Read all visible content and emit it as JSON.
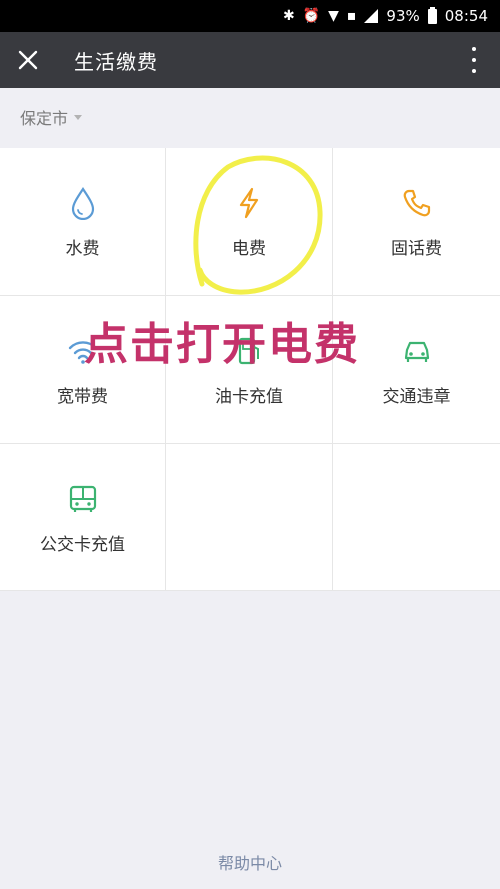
{
  "status_bar": {
    "battery": "93%",
    "time": "08:54"
  },
  "header": {
    "title": "生活缴费"
  },
  "city_selector": {
    "value": "保定市"
  },
  "services": [
    {
      "label": "水费",
      "icon": "water-drop-icon",
      "color": "#5b9bd5"
    },
    {
      "label": "电费",
      "icon": "lightning-icon",
      "color": "#f0a020"
    },
    {
      "label": "固话费",
      "icon": "phone-icon",
      "color": "#f0a020"
    },
    {
      "label": "宽带费",
      "icon": "wifi-icon",
      "color": "#5b9bd5"
    },
    {
      "label": "油卡充值",
      "icon": "fuel-icon",
      "color": "#3cb371"
    },
    {
      "label": "交通违章",
      "icon": "car-icon",
      "color": "#3cb371"
    },
    {
      "label": "公交卡充值",
      "icon": "bus-icon",
      "color": "#3cb371"
    }
  ],
  "annotation": {
    "text": "点击打开电费",
    "color": "#c4326a",
    "circle_color": "#f2ef4a"
  },
  "footer": {
    "help_label": "帮助中心"
  }
}
